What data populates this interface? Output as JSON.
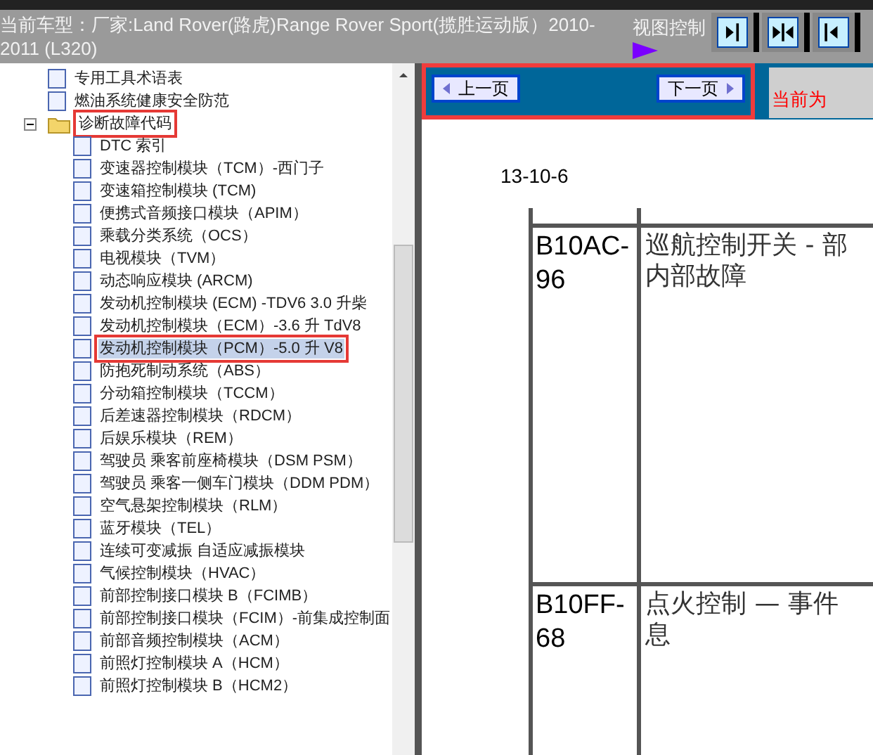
{
  "header": {
    "title": "当前车型：厂家:Land Rover(路虎)Range Rover Sport(揽胜运动版）2010-2011 (L320)",
    "view_label": "视图控制"
  },
  "tree": [
    {
      "label": "专用工具术语表",
      "selected": false,
      "annotated": false
    },
    {
      "label": "燃油系统健康安全防范",
      "selected": false,
      "annotated": false
    },
    {
      "label": "诊断故障代码",
      "selected": false,
      "annotated": true,
      "expanded": true,
      "children": [
        {
          "label": "DTC 索引",
          "selected": false,
          "annotated": false
        },
        {
          "label": "变速器控制模块（TCM）-西门子",
          "selected": false,
          "annotated": false
        },
        {
          "label": "变速箱控制模块 (TCM)",
          "selected": false,
          "annotated": false
        },
        {
          "label": "便携式音频接口模块（APIM）",
          "selected": false,
          "annotated": false
        },
        {
          "label": "乘载分类系统（OCS）",
          "selected": false,
          "annotated": false
        },
        {
          "label": "电视模块（TVM）",
          "selected": false,
          "annotated": false
        },
        {
          "label": "动态响应模块 (ARCM)",
          "selected": false,
          "annotated": false
        },
        {
          "label": "发动机控制模块 (ECM) -TDV6 3.0 升柴",
          "selected": false,
          "annotated": false
        },
        {
          "label": "发动机控制模块（ECM）-3.6 升 TdV8",
          "selected": false,
          "annotated": false
        },
        {
          "label": "发动机控制模块（PCM）-5.0 升 V8",
          "selected": true,
          "annotated": true
        },
        {
          "label": "防抱死制动系统（ABS）",
          "selected": false,
          "annotated": false
        },
        {
          "label": "分动箱控制模块（TCCM）",
          "selected": false,
          "annotated": false
        },
        {
          "label": "后差速器控制模块（RDCM）",
          "selected": false,
          "annotated": false
        },
        {
          "label": "后娱乐模块（REM）",
          "selected": false,
          "annotated": false
        },
        {
          "label": "驾驶员 乘客前座椅模块（DSM PSM）",
          "selected": false,
          "annotated": false
        },
        {
          "label": "驾驶员 乘客一侧车门模块（DDM PDM）",
          "selected": false,
          "annotated": false
        },
        {
          "label": "空气悬架控制模块（RLM）",
          "selected": false,
          "annotated": false
        },
        {
          "label": "蓝牙模块（TEL）",
          "selected": false,
          "annotated": false
        },
        {
          "label": "连续可变减振 自适应减振模块",
          "selected": false,
          "annotated": false
        },
        {
          "label": "气候控制模块（HVAC）",
          "selected": false,
          "annotated": false
        },
        {
          "label": "前部控制接口模块 B（FCIMB）",
          "selected": false,
          "annotated": false
        },
        {
          "label": "前部控制接口模块（FCIM）-前集成控制面",
          "selected": false,
          "annotated": false
        },
        {
          "label": "前部音频控制模块（ACM）",
          "selected": false,
          "annotated": false
        },
        {
          "label": "前照灯控制模块 A（HCM）",
          "selected": false,
          "annotated": false
        },
        {
          "label": "前照灯控制模块 B（HCM2）",
          "selected": false,
          "annotated": false
        }
      ]
    }
  ],
  "nav": {
    "annotated": true,
    "prev": "上一页",
    "next": "下一页",
    "status": "当前为"
  },
  "document": {
    "page_number": "13-10-6",
    "rows": [
      {
        "code": "B10AC-96",
        "description": [
          "巡航控制开关 - 部",
          "内部故障"
        ]
      },
      {
        "code": "B10FF-68",
        "description": [
          "点火控制 — 事件",
          "息"
        ]
      }
    ]
  }
}
